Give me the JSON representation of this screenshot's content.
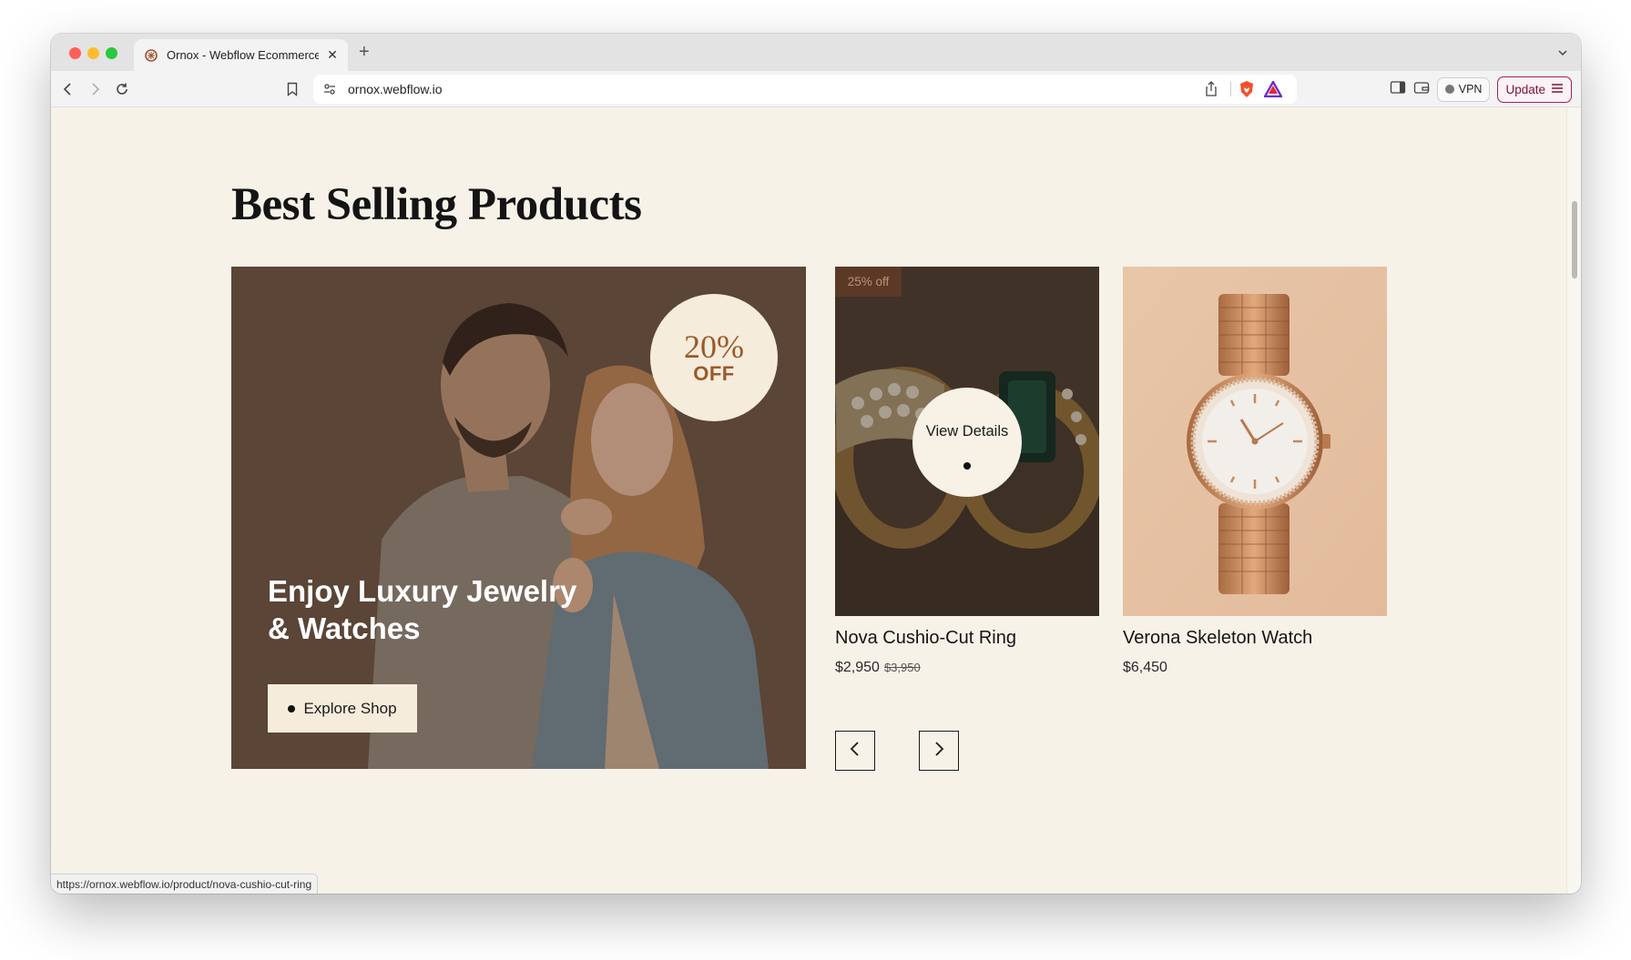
{
  "browser": {
    "tab": {
      "title": "Ornox - Webflow Ecommerce Website Template",
      "favicon": "ornox-favicon-icon"
    },
    "new_tab": "+",
    "close": "✕",
    "url": "ornox.webflow.io",
    "vpn_label": "VPN",
    "update_label": "Update",
    "status_url": "https://ornox.webflow.io/product/nova-cushio-cut-ring"
  },
  "section": {
    "heading": "Best Selling Products"
  },
  "hero": {
    "discount_percent": "20%",
    "discount_off": "OFF",
    "title": "Enjoy Luxury Jewelry & Watches",
    "cta": "Explore Shop"
  },
  "products": [
    {
      "name": "Nova Cushio-Cut Ring",
      "price": "$2,950",
      "old_price": "$3,950",
      "sale_tag": "25% off",
      "hover_label": "View Details"
    },
    {
      "name": "Verona Skeleton Watch",
      "price": "$6,450"
    }
  ],
  "colors": {
    "page_bg": "#f6f2e8",
    "cream": "#f6ecdc",
    "brand_brown": "#9a5a2a",
    "update_accent": "#a0224a"
  }
}
